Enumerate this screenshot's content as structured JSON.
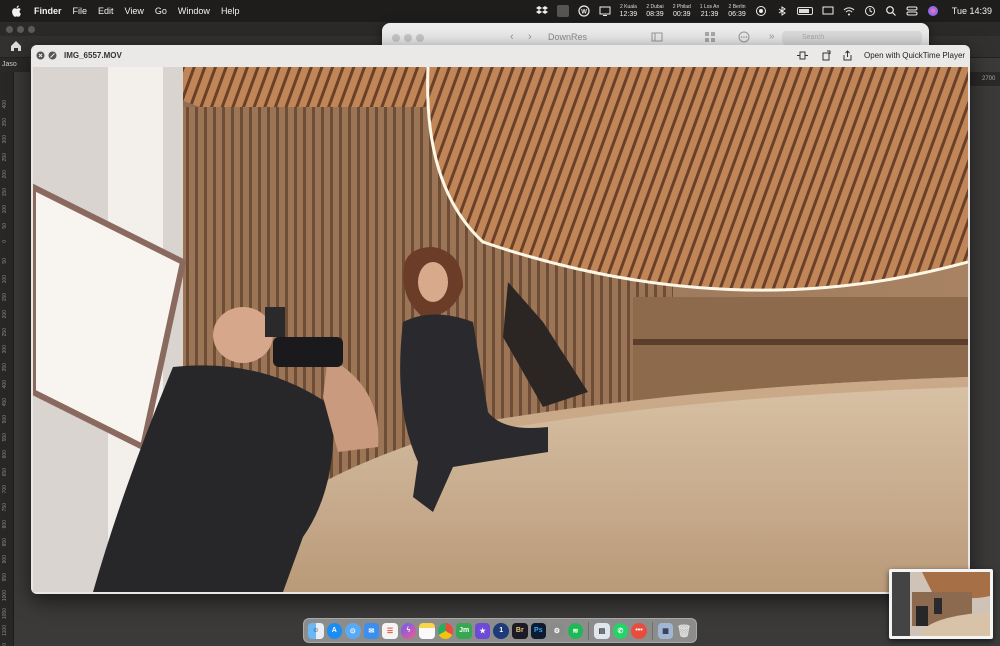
{
  "menubar": {
    "app_name": "Finder",
    "menus": [
      "File",
      "Edit",
      "View",
      "Go",
      "Window",
      "Help"
    ],
    "clocks": [
      {
        "city": "2 Kuala",
        "time": "12:39"
      },
      {
        "city": "2 Dubai",
        "time": "08:39"
      },
      {
        "city": "2 Philad",
        "time": "00:39"
      },
      {
        "city": "1 Los An",
        "time": "21:39"
      },
      {
        "city": "2 Berlin",
        "time": "06:39"
      }
    ],
    "datetime": "Tue 14:39"
  },
  "background_app": {
    "tab_label": "Jaso",
    "ruler_top_value": "2700",
    "ruler_left_marks": [
      "400",
      "350",
      "300",
      "250",
      "200",
      "150",
      "100",
      "50",
      "0",
      "50",
      "100",
      "150",
      "200",
      "250",
      "300",
      "350",
      "400",
      "450",
      "500",
      "550",
      "600",
      "650",
      "700",
      "750",
      "800",
      "850",
      "900",
      "950",
      "1000",
      "1050",
      "1100",
      "1150",
      "1200"
    ]
  },
  "finder": {
    "title": "DownRes",
    "search_placeholder": "Search"
  },
  "quicklook": {
    "filename": "IMG_6557.MOV",
    "open_with_label": "Open with QuickTime Player"
  },
  "dock": {
    "icons": [
      "finder-icon",
      "appstore-icon",
      "safari-icon",
      "mail-icon",
      "reminders-icon",
      "messenger-icon",
      "notes-icon",
      "chrome-icon",
      "jamf-icon",
      "imovie-icon",
      "1password-icon",
      "bridge-icon",
      "photoshop-icon",
      "system-settings-icon",
      "spotify-icon",
      "preview-icon",
      "whatsapp-icon",
      "more-icon",
      "downloads-icon",
      "trash-icon"
    ],
    "labels": {
      "jamf": "Jm",
      "bridge": "Br",
      "photoshop": "Ps",
      "onepassword": "1"
    }
  },
  "colors": {
    "menubar_bg": "#1e1d1c",
    "window_chrome": "#ebe9e7",
    "wood": "#b07a4e"
  }
}
